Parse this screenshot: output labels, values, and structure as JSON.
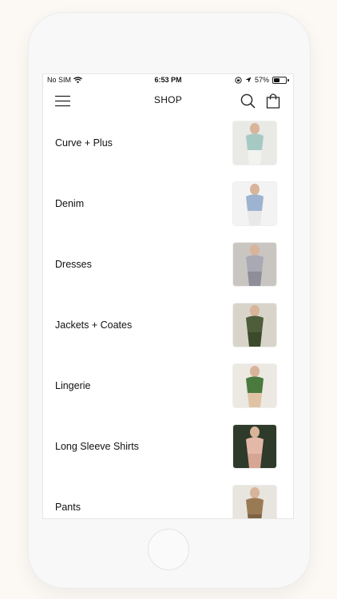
{
  "status": {
    "carrier": "No SIM",
    "time": "6:53 PM",
    "battery": "57%",
    "battery_level": 0.57
  },
  "header": {
    "title": "SHOP",
    "icons": [
      "menu-icon",
      "search-icon",
      "bag-icon"
    ]
  },
  "categories": [
    {
      "label": "Curve + Plus",
      "thumb_colors": [
        "#e9e9e6",
        "#a7c9c4",
        "#f2f2f0"
      ]
    },
    {
      "label": "Denim",
      "thumb_colors": [
        "#f3f3f3",
        "#9db3cf",
        "#e8e8e8"
      ]
    },
    {
      "label": "Dresses",
      "thumb_colors": [
        "#c9c6c2",
        "#a9a9b4",
        "#8e8d98"
      ]
    },
    {
      "label": "Jackets + Coates",
      "thumb_colors": [
        "#d9d4c9",
        "#4e5d3a",
        "#3c4a2c"
      ]
    },
    {
      "label": "Lingerie",
      "thumb_colors": [
        "#ece8e2",
        "#4a7a3e",
        "#e0c2a4"
      ]
    },
    {
      "label": "Long Sleeve Shirts",
      "thumb_colors": [
        "#2e3a2a",
        "#e4b8a8",
        "#d7a594"
      ]
    },
    {
      "label": "Pants",
      "thumb_colors": [
        "#e8e4de",
        "#9a7a55",
        "#7d6245"
      ]
    }
  ]
}
